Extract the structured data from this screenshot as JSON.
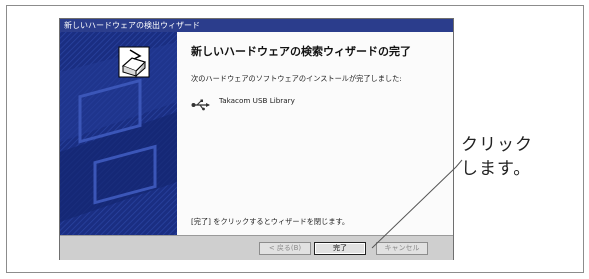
{
  "dialog": {
    "title": "新しいハードウェアの検出ウィザード",
    "heading": "新しいハードウェアの検索ウィザードの完了",
    "message": "次のハードウェアのソフトウェアのインストールが完了しました:",
    "device_name": "Takacom USB Library",
    "close_note": "[完了] をクリックするとウィザードを閉じます。",
    "buttons": {
      "back": "< 戻る(B)",
      "finish": "完了",
      "cancel": "キャンセル"
    }
  },
  "callout": {
    "line1": "クリック",
    "line2": "します。"
  },
  "icons": [
    "wizard-box-icon",
    "usb-icon"
  ]
}
